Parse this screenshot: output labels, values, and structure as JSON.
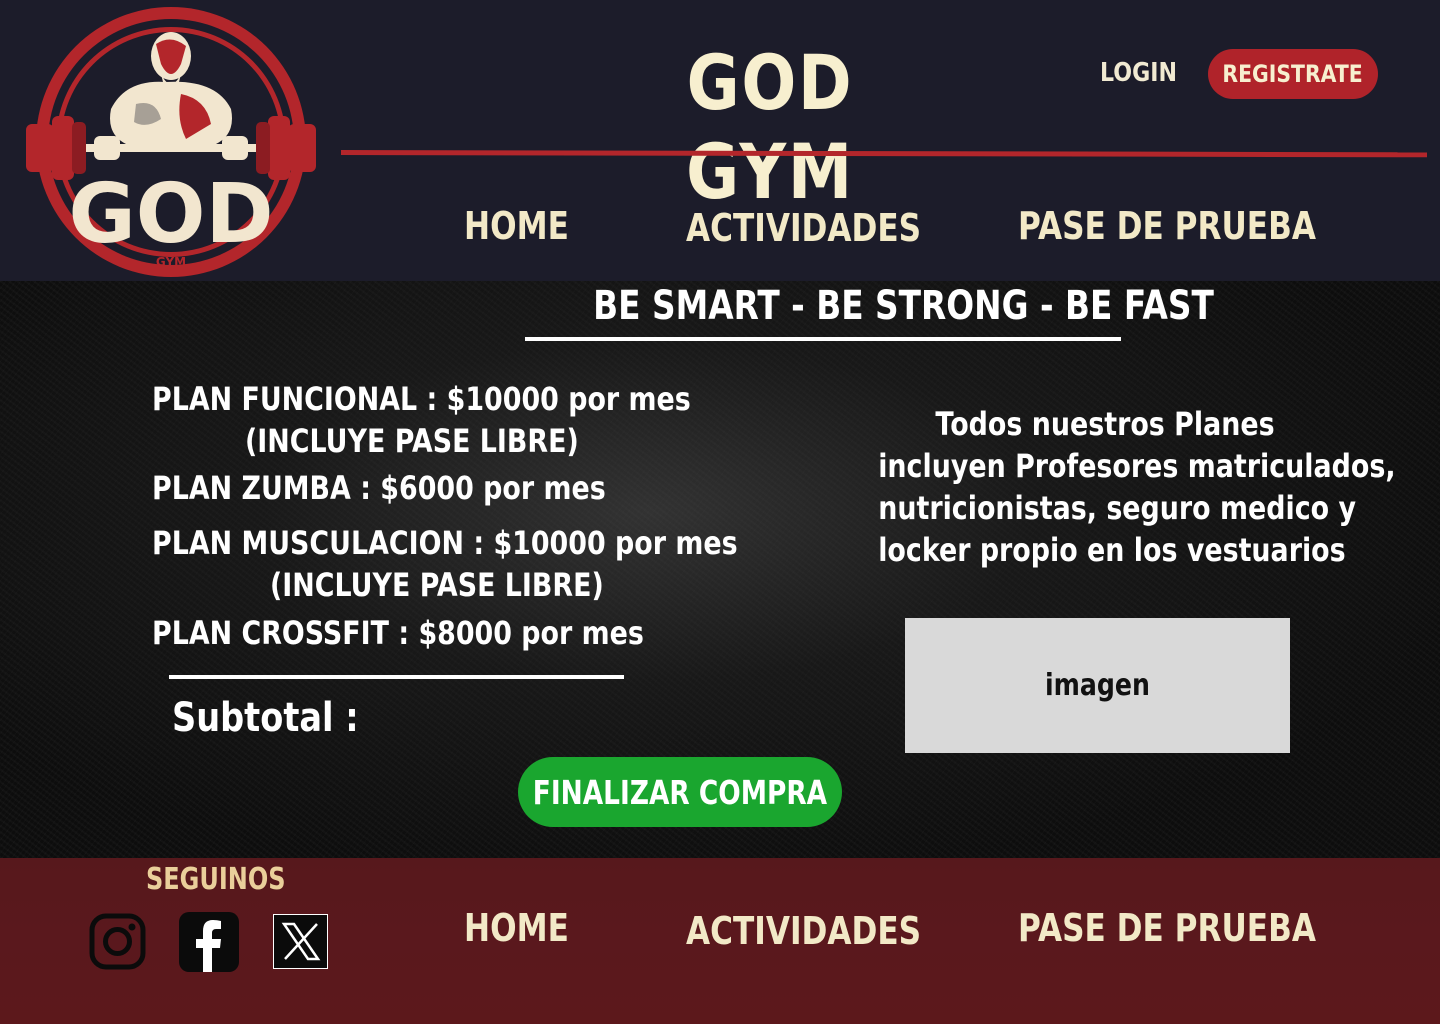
{
  "header": {
    "site_title": "GOD GYM",
    "login_label": "LOGIN",
    "register_label": "REGISTRATE",
    "logo_text": "GOD",
    "logo_subtext": "GYM",
    "nav": [
      {
        "label": "HOME"
      },
      {
        "label": "ACTIVIDADES"
      },
      {
        "label": "PASE DE PRUEBA"
      }
    ]
  },
  "main": {
    "slogan": "BE SMART - BE STRONG - BE FAST",
    "plans": [
      {
        "text": "PLAN FUNCIONAL : $10000 por mes",
        "note": "(INCLUYE PASE LIBRE)"
      },
      {
        "text": "PLAN ZUMBA : $6000 por mes",
        "note": ""
      },
      {
        "text": "PLAN MUSCULACION : $10000 por mes",
        "note": "(INCLUYE PASE LIBRE)"
      },
      {
        "text": "PLAN CROSSFIT : $8000 por mes",
        "note": ""
      }
    ],
    "subtotal_label": "Subtotal :",
    "finalize_label": "FINALIZAR COMPRA",
    "info_lines": [
      "Todos nuestros Planes",
      "incluyen Profesores matriculados,",
      "nutricionistas, seguro medico y",
      "locker propio en los vestuarios"
    ],
    "image_placeholder": "imagen"
  },
  "footer": {
    "follow_label": "SEGUINOS",
    "social": [
      "instagram-icon",
      "facebook-icon",
      "x-icon"
    ],
    "nav": [
      {
        "label": "HOME"
      },
      {
        "label": "ACTIVIDADES"
      },
      {
        "label": "PASE DE PRUEBA"
      }
    ]
  },
  "colors": {
    "header_bg": "#1c1c2a",
    "accent_red": "#b0232a",
    "cream": "#f7efcf",
    "green_button": "#1aa62f",
    "footer_bg": "#57181c"
  }
}
